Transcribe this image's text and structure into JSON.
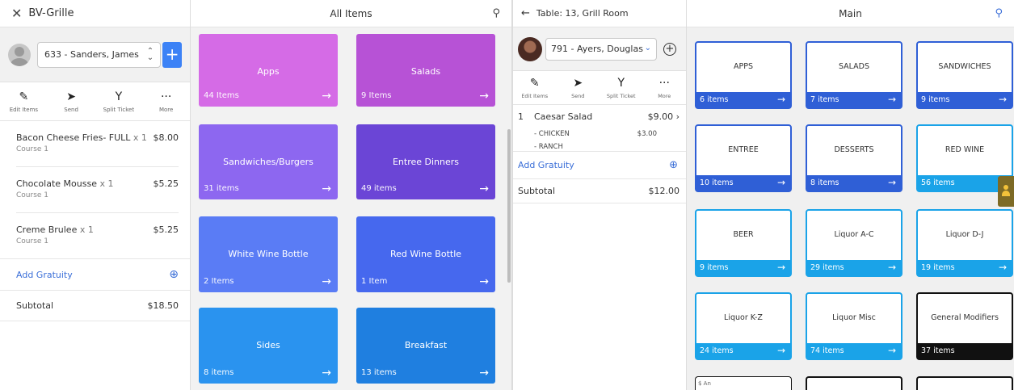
{
  "left_app": {
    "title": "BV-Grille",
    "customer": "633 - Sanders, James",
    "actions": [
      "Edit Items",
      "Send",
      "Split Ticket",
      "More"
    ],
    "items": [
      {
        "name": "Bacon Cheese Fries- FULL",
        "qty": "x 1",
        "price": "$8.00",
        "course": "Course 1"
      },
      {
        "name": "Chocolate Mousse",
        "qty": "x 1",
        "price": "$5.25",
        "course": "Course 1"
      },
      {
        "name": "Creme Brulee",
        "qty": "x 1",
        "price": "$5.25",
        "course": "Course 1"
      }
    ],
    "gratuity_label": "Add Gratuity",
    "subtotal_label": "Subtotal",
    "subtotal_value": "$18.50",
    "menu_title": "All Items",
    "tiles": [
      {
        "name": "Apps",
        "count": "44 Items"
      },
      {
        "name": "Salads",
        "count": "9 Items"
      },
      {
        "name": "Sandwiches/Burgers",
        "count": "31 items"
      },
      {
        "name": "Entree Dinners",
        "count": "49 items"
      },
      {
        "name": "White Wine Bottle",
        "count": "2 Items"
      },
      {
        "name": "Red Wine Bottle",
        "count": "1 Item"
      },
      {
        "name": "Sides",
        "count": "8 items"
      },
      {
        "name": "Breakfast",
        "count": "13 items"
      }
    ]
  },
  "right_app": {
    "title": "Table: 13, Grill Room",
    "customer": "791 - Ayers, Douglas",
    "actions": [
      "Edit Items",
      "Send",
      "Split Ticket",
      "More"
    ],
    "item": {
      "num": "1",
      "name": "Caesar Salad",
      "price": "$9.00",
      "mods": [
        {
          "name": "- CHICKEN",
          "price": "$3.00"
        },
        {
          "name": "- RANCH",
          "price": ""
        }
      ]
    },
    "gratuity_label": "Add Gratuity",
    "subtotal_label": "Subtotal",
    "subtotal_value": "$12.00",
    "menu_title": "Main",
    "categories": [
      {
        "name": "APPS",
        "count": "6 items"
      },
      {
        "name": "SALADS",
        "count": "7 items"
      },
      {
        "name": "SANDWICHES",
        "count": "9 items"
      },
      {
        "name": "ENTREE",
        "count": "10 items"
      },
      {
        "name": "DESSERTS",
        "count": "8 items"
      },
      {
        "name": "RED WINE",
        "count": "56 items"
      },
      {
        "name": "BEER",
        "count": "9 items"
      },
      {
        "name": "Liquor A-C",
        "count": "29 items"
      },
      {
        "name": "Liquor D-J",
        "count": "19 items"
      },
      {
        "name": "Liquor K-Z",
        "count": "24 items"
      },
      {
        "name": "Liquor Misc",
        "count": "74 items"
      },
      {
        "name": "General Modifiers",
        "count": "37 items"
      }
    ],
    "stub_text": "$ An"
  },
  "colors": {
    "apps": "#d56be6",
    "salads": "#b752d6",
    "sandwiches": "#8d67f0",
    "entree": "#6b45d6",
    "white_wine": "#5a7cf5",
    "red_wine": "#4668ee",
    "sides": "#2a93ef",
    "breakfast": "#1f7fe0",
    "accent_blue": "#2f5fd6",
    "accent_cyan": "#1aa3e8",
    "link": "#3b6fd8"
  }
}
